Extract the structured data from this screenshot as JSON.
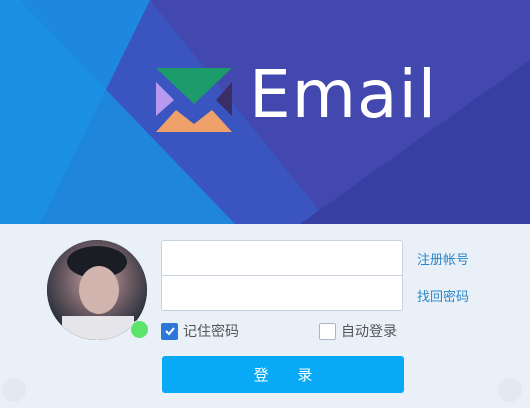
{
  "brand": {
    "name": "Email"
  },
  "login": {
    "username_value": "",
    "password_value": "",
    "register_link": "注册帐号",
    "forgot_link": "找回密码",
    "remember_label": "记住密码",
    "remember_checked": true,
    "auto_login_label": "自动登录",
    "auto_login_checked": false,
    "submit_label": "登 录"
  },
  "status": {
    "online_color": "#5be36c"
  },
  "colors": {
    "banner": "#3f4bb0",
    "button": "#08a9f5",
    "link": "#2d86c7",
    "panel": "#e9f0f7"
  },
  "icons": {
    "logo": "email-envelope-logo-icon",
    "avatar": "user-avatar",
    "check": "check-icon"
  }
}
